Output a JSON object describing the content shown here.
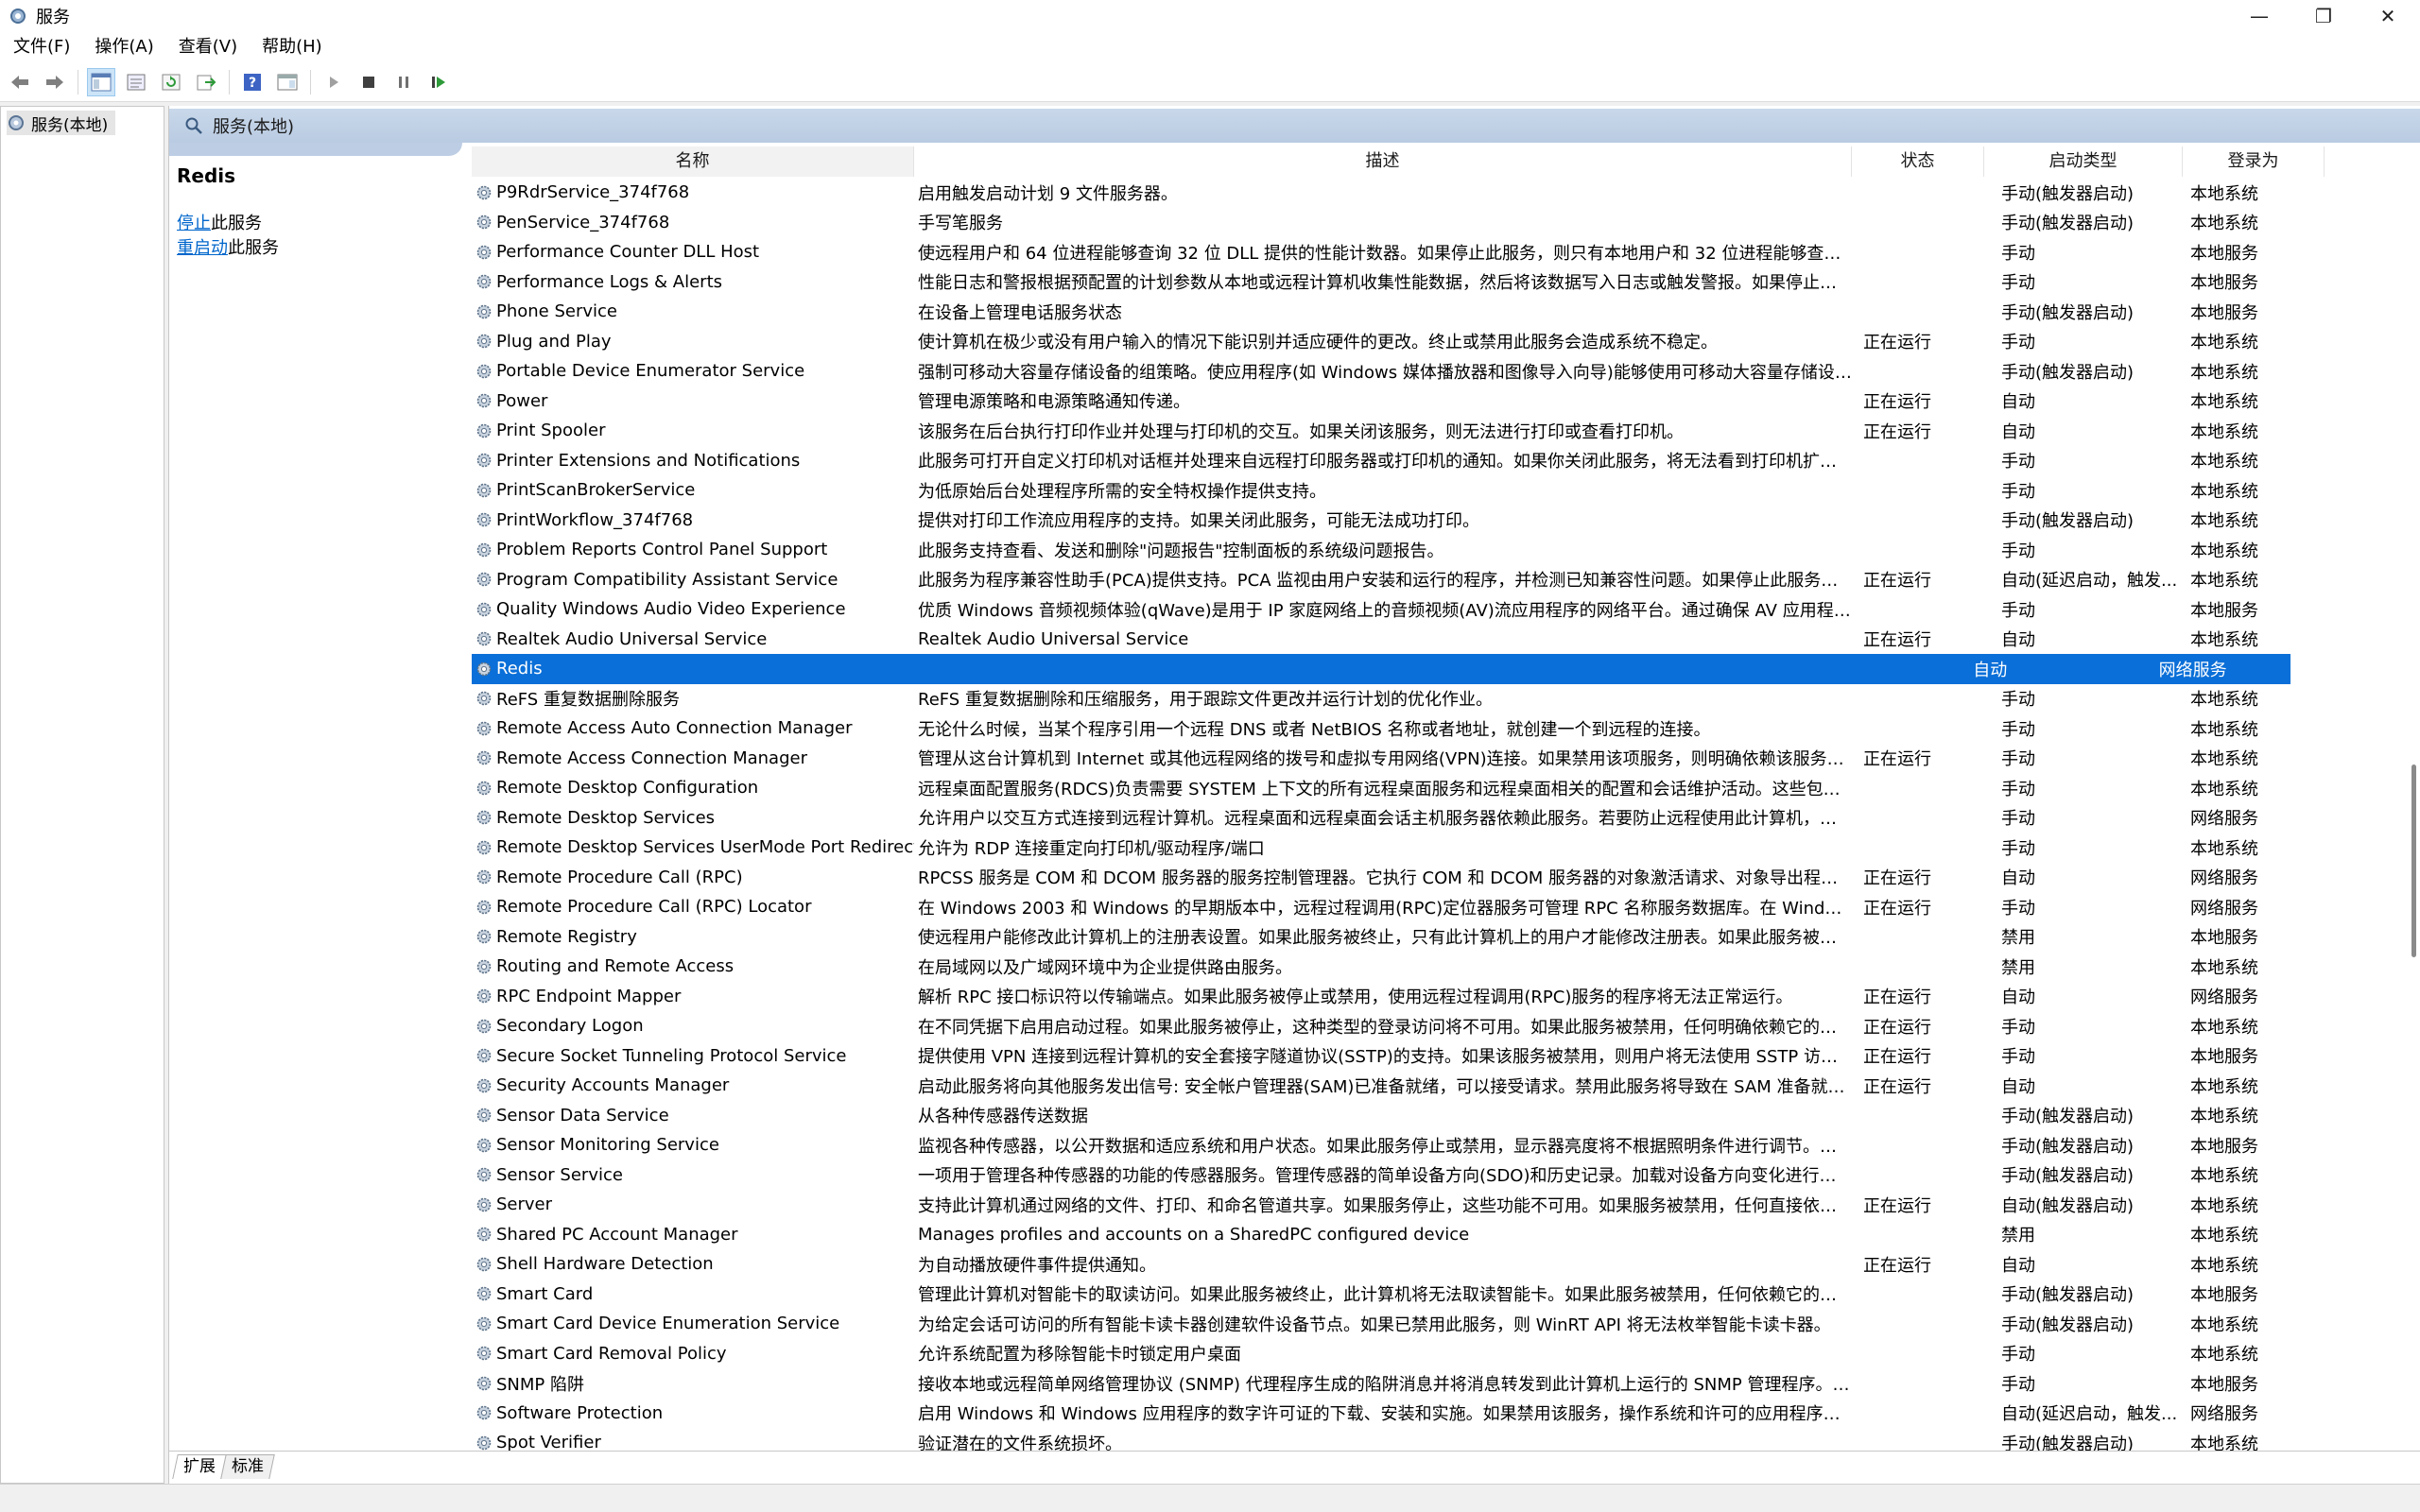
{
  "window": {
    "title": "服务",
    "minimize": "—",
    "maximize": "❐",
    "close": "✕"
  },
  "menu": [
    "文件(F)",
    "操作(A)",
    "查看(V)",
    "帮助(H)"
  ],
  "tree": {
    "root_label": "服务(本地)"
  },
  "header": {
    "title": "服务(本地)"
  },
  "detail": {
    "service_name": "Redis",
    "stop_link": "停止",
    "stop_suffix": "此服务",
    "restart_link": "重启动",
    "restart_suffix": "此服务"
  },
  "columns": {
    "name": "名称",
    "desc": "描述",
    "status": "状态",
    "startup": "启动类型",
    "logon": "登录为"
  },
  "services": [
    [
      "P9RdrService_374f768",
      "启用触发启动计划 9 文件服务器。",
      "",
      "手动(触发器启动)",
      "本地系统"
    ],
    [
      "PenService_374f768",
      "手写笔服务",
      "",
      "手动(触发器启动)",
      "本地系统"
    ],
    [
      "Performance Counter DLL Host",
      "使远程用户和 64 位进程能够查询 32 位 DLL 提供的性能计数器。如果停止此服务，则只有本地用户和 32 位进程能够查询 3...",
      "",
      "手动",
      "本地服务"
    ],
    [
      "Performance Logs & Alerts",
      "性能日志和警报根据预配置的计划参数从本地或远程计算机收集性能数据，然后将该数据写入日志或触发警报。如果停止此...",
      "",
      "手动",
      "本地服务"
    ],
    [
      "Phone Service",
      "在设备上管理电话服务状态",
      "",
      "手动(触发器启动)",
      "本地服务"
    ],
    [
      "Plug and Play",
      "使计算机在极少或没有用户输入的情况下能识别并适应硬件的更改。终止或禁用此服务会造成系统不稳定。",
      "正在运行",
      "手动",
      "本地系统"
    ],
    [
      "Portable Device Enumerator Service",
      "强制可移动大容量存储设备的组策略。使应用程序(如 Windows 媒体播放器和图像导入向导)能够使用可移动大容量存储设备...",
      "",
      "手动(触发器启动)",
      "本地系统"
    ],
    [
      "Power",
      "管理电源策略和电源策略通知传递。",
      "正在运行",
      "自动",
      "本地系统"
    ],
    [
      "Print Spooler",
      "该服务在后台执行打印作业并处理与打印机的交互。如果关闭该服务，则无法进行打印或查看打印机。",
      "正在运行",
      "自动",
      "本地系统"
    ],
    [
      "Printer Extensions and Notifications",
      "此服务可打开自定义打印机对话框并处理来自远程打印服务器或打印机的通知。如果你关闭此服务，将无法看到打印机扩展...",
      "",
      "手动",
      "本地系统"
    ],
    [
      "PrintScanBrokerService",
      "为低原始后台处理程序所需的安全特权操作提供支持。",
      "",
      "手动",
      "本地系统"
    ],
    [
      "PrintWorkflow_374f768",
      "提供对打印工作流应用程序的支持。如果关闭此服务，可能无法成功打印。",
      "",
      "手动(触发器启动)",
      "本地系统"
    ],
    [
      "Problem Reports Control Panel Support",
      "此服务支持查看、发送和删除\"问题报告\"控制面板的系统级问题报告。",
      "",
      "手动",
      "本地系统"
    ],
    [
      "Program Compatibility Assistant Service",
      "此服务为程序兼容性助手(PCA)提供支持。PCA 监视由用户安装和运行的程序，并检测已知兼容性问题。如果停止此服务，P...",
      "正在运行",
      "自动(延迟启动，触发...",
      "本地系统"
    ],
    [
      "Quality Windows Audio Video Experience",
      "优质 Windows 音频视频体验(qWave)是用于 IP 家庭网络上的音频视频(AV)流应用程序的网络平台。通过确保 AV 应用程序...",
      "",
      "手动",
      "本地服务"
    ],
    [
      "Realtek Audio Universal Service",
      "Realtek Audio Universal Service",
      "正在运行",
      "自动",
      "本地系统"
    ],
    [
      "Redis",
      "",
      "",
      "自动",
      "网络服务"
    ],
    [
      "ReFS 重复数据删除服务",
      "ReFS 重复数据删除和压缩服务，用于跟踪文件更改并运行计划的优化作业。",
      "",
      "手动",
      "本地系统"
    ],
    [
      "Remote Access Auto Connection Manager",
      "无论什么时候，当某个程序引用一个远程 DNS 或者 NetBIOS 名称或者地址，就创建一个到远程的连接。",
      "",
      "手动",
      "本地系统"
    ],
    [
      "Remote Access Connection Manager",
      "管理从这台计算机到 Internet 或其他远程网络的拨号和虚拟专用网络(VPN)连接。如果禁用该项服务，则明确依赖该服务的...",
      "正在运行",
      "手动",
      "本地系统"
    ],
    [
      "Remote Desktop Configuration",
      "远程桌面配置服务(RDCS)负责需要 SYSTEM 上下文的所有远程桌面服务和远程桌面相关的配置和会话维护活动。这些包括每...",
      "",
      "手动",
      "本地系统"
    ],
    [
      "Remote Desktop Services",
      "允许用户以交互方式连接到远程计算机。远程桌面和远程桌面会话主机服务器依赖此服务。若要防止远程使用此计算机，请...",
      "",
      "手动",
      "网络服务"
    ],
    [
      "Remote Desktop Services UserMode Port Redirector",
      "允许为 RDP 连接重定向打印机/驱动程序/端口",
      "",
      "手动",
      "本地系统"
    ],
    [
      "Remote Procedure Call (RPC)",
      "RPCSS 服务是 COM 和 DCOM 服务器的服务控制管理器。它执行 COM 和 DCOM 服务器的对象激活请求、对象导出程序解...",
      "正在运行",
      "自动",
      "网络服务"
    ],
    [
      "Remote Procedure Call (RPC) Locator",
      "在 Windows 2003 和 Windows 的早期版本中，远程过程调用(RPC)定位器服务可管理 RPC 名称服务数据库。在 Windows Vi...",
      "正在运行",
      "手动",
      "网络服务"
    ],
    [
      "Remote Registry",
      "使远程用户能修改此计算机上的注册表设置。如果此服务被终止，只有此计算机上的用户才能修改注册表。如果此服务被禁...",
      "",
      "禁用",
      "本地服务"
    ],
    [
      "Routing and Remote Access",
      "在局域网以及广域网环境中为企业提供路由服务。",
      "",
      "禁用",
      "本地系统"
    ],
    [
      "RPC Endpoint Mapper",
      "解析 RPC 接口标识符以传输端点。如果此服务被停止或禁用，使用远程过程调用(RPC)服务的程序将无法正常运行。",
      "正在运行",
      "自动",
      "网络服务"
    ],
    [
      "Secondary Logon",
      "在不同凭据下启用启动过程。如果此服务被停止，这种类型的登录访问将不可用。如果此服务被禁用，任何明确依赖它的服...",
      "正在运行",
      "手动",
      "本地系统"
    ],
    [
      "Secure Socket Tunneling Protocol Service",
      "提供使用 VPN 连接到远程计算机的安全套接字隧道协议(SSTP)的支持。如果该服务被禁用，则用户将无法使用 SSTP 访问远...",
      "正在运行",
      "手动",
      "本地服务"
    ],
    [
      "Security Accounts Manager",
      "启动此服务将向其他服务发出信号: 安全帐户管理器(SAM)已准备就绪，可以接受请求。禁用此服务将导致在 SAM 准备就绪...",
      "正在运行",
      "自动",
      "本地系统"
    ],
    [
      "Sensor Data Service",
      "从各种传感器传送数据",
      "",
      "手动(触发器启动)",
      "本地系统"
    ],
    [
      "Sensor Monitoring Service",
      "监视各种传感器，以公开数据和适应系统和用户状态。如果此服务停止或禁用，显示器亮度将不根据照明条件进行调节。停...",
      "",
      "手动(触发器启动)",
      "本地服务"
    ],
    [
      "Sensor Service",
      "一项用于管理各种传感器的功能的传感器服务。管理传感器的简单设备方向(SDO)和历史记录。加载对设备方向变化进行报...",
      "",
      "手动(触发器启动)",
      "本地系统"
    ],
    [
      "Server",
      "支持此计算机通过网络的文件、打印、和命名管道共享。如果服务停止，这些功能不可用。如果服务被禁用，任何直接依赖...",
      "正在运行",
      "自动(触发器启动)",
      "本地系统"
    ],
    [
      "Shared PC Account Manager",
      "Manages profiles and accounts on a SharedPC configured device",
      "",
      "禁用",
      "本地系统"
    ],
    [
      "Shell Hardware Detection",
      "为自动播放硬件事件提供通知。",
      "正在运行",
      "自动",
      "本地系统"
    ],
    [
      "Smart Card",
      "管理此计算机对智能卡的取读访问。如果此服务被终止，此计算机将无法取读智能卡。如果此服务被禁用，任何依赖它的服...",
      "",
      "手动(触发器启动)",
      "本地服务"
    ],
    [
      "Smart Card Device Enumeration Service",
      "为给定会话可访问的所有智能卡读卡器创建软件设备节点。如果已禁用此服务，则 WinRT API 将无法枚举智能卡读卡器。",
      "",
      "手动(触发器启动)",
      "本地系统"
    ],
    [
      "Smart Card Removal Policy",
      "允许系统配置为移除智能卡时锁定用户桌面",
      "",
      "手动",
      "本地系统"
    ],
    [
      "SNMP 陷阱",
      "接收本地或远程简单网络管理协议 (SNMP) 代理程序生成的陷阱消息并将消息转发到此计算机上运行的 SNMP 管理程序。如...",
      "",
      "手动",
      "本地服务"
    ],
    [
      "Software Protection",
      "启用 Windows 和 Windows 应用程序的数字许可证的下载、安装和实施。如果禁用该服务，操作系统和许可的应用程序可能...",
      "",
      "自动(延迟启动，触发...",
      "网络服务"
    ],
    [
      "Spot Verifier",
      "验证潜在的文件系统损坏。",
      "",
      "手动(触发器启动)",
      "本地系统"
    ]
  ],
  "selected_index": 16,
  "tabs": [
    "扩展",
    "标准"
  ],
  "colors": {
    "selection": "#0a6fd8",
    "link": "#0066cc",
    "header_band": "#c9d8ea"
  }
}
